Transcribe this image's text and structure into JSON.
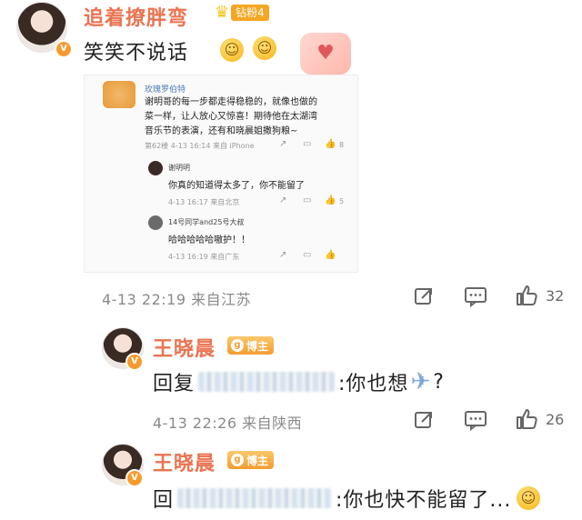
{
  "main_comment": {
    "username": "追着撩胖弯",
    "fan_badge": "钻粉4",
    "text": "笑笑不说话",
    "meta": "4-13 22:19 来自江苏",
    "like_count": "32"
  },
  "embedded_post": {
    "author": "玫瑰罗伯特",
    "text_line1": "谢明哥的每一步都走得稳稳的，就像也做的",
    "text_line2": "菜一样，让人放心又惊喜！期待他在太湖湾",
    "text_line3": "音乐节的表演，还有和晓晨姐撒狗粮~",
    "meta": "第62楼 4-13 16:14 来自 iPhone",
    "like_count": "8",
    "reply1": {
      "author": "谢明明",
      "text": "你真的知道得太多了，你不能留了",
      "meta": "4-13 16:17 来自北京",
      "like_count": "5"
    },
    "reply2": {
      "author": "14号同学and25号大叔",
      "text": "哈哈哈哈哈嗷护！！",
      "meta": "4-13 16:19 来自广东"
    }
  },
  "reply_1": {
    "username": "王晓晨",
    "badge": "博主",
    "prefix": "回复",
    "text": ":你也想",
    "tail": "?",
    "meta": "4-13 22:26 来自陕西",
    "like_count": "26"
  },
  "reply_2": {
    "username": "王晓晨",
    "badge": "博主",
    "prefix": "回",
    "text": ":你也快不能留了...",
    "like_count": ""
  },
  "icons": {
    "v_badge": "V",
    "crown": "♛",
    "plane": "✈",
    "share": "share-icon",
    "comment": "comment-icon",
    "like": "like-icon"
  },
  "colors": {
    "username": "#eb7350",
    "badge_orange": "#f39c2f",
    "meta_gray": "#8a8a8a"
  }
}
